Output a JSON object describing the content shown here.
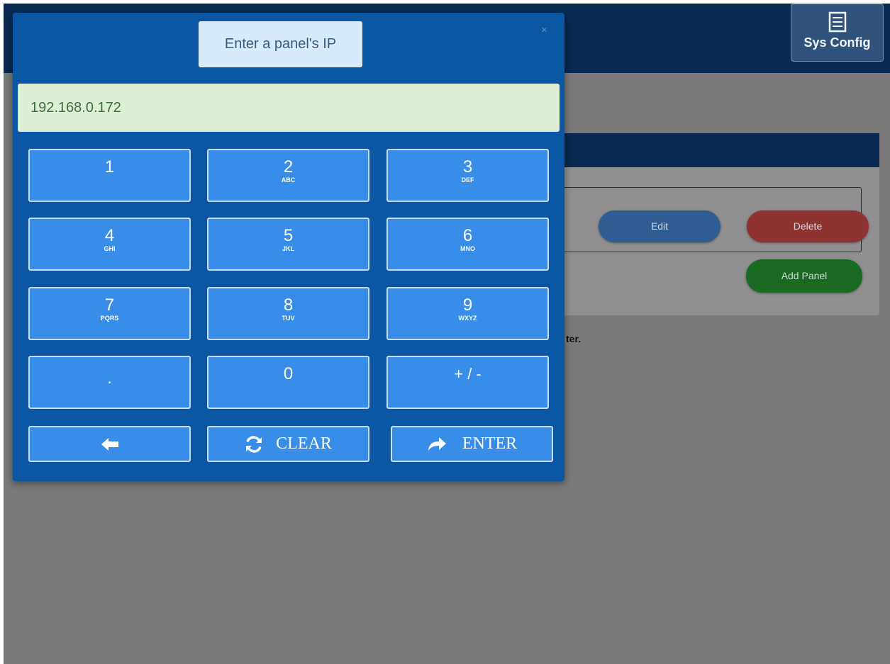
{
  "topbar": {
    "sys_config_label": "Sys Config",
    "sys_config_icon": "list-icon"
  },
  "panel_row": {
    "edit_label": "Edit",
    "delete_label": "Delete"
  },
  "card": {
    "add_panel_label": "Add Panel"
  },
  "hint": {
    "text": "ter."
  },
  "keypad_modal": {
    "title": "Enter a panel's IP",
    "close_symbol": "×",
    "value": "192.168.0.172",
    "keys": [
      {
        "main": "1",
        "sub": ""
      },
      {
        "main": "2",
        "sub": "ABC"
      },
      {
        "main": "3",
        "sub": "DEF"
      },
      {
        "main": "4",
        "sub": "GHI"
      },
      {
        "main": "5",
        "sub": "JKL"
      },
      {
        "main": "6",
        "sub": "MNO"
      },
      {
        "main": "7",
        "sub": "PQRS"
      },
      {
        "main": "8",
        "sub": "TUV"
      },
      {
        "main": "9",
        "sub": "WXYZ"
      },
      {
        "main": ".",
        "sub": ""
      },
      {
        "main": "0",
        "sub": ""
      },
      {
        "main": "+ / -",
        "sub": ""
      }
    ],
    "backspace_icon": "arrow-left-icon",
    "clear_label": "CLEAR",
    "clear_icon": "refresh-icon",
    "enter_label": "ENTER",
    "enter_icon": "share-arrow-icon"
  },
  "colors": {
    "topbar": "#082a52",
    "modal": "#0b57a4",
    "key": "#388de8",
    "display_bg": "#deefd8",
    "display_text": "#3b6e3a",
    "edit": "#2f5d93",
    "delete": "#8e3232",
    "add_panel": "#1b6a22"
  }
}
